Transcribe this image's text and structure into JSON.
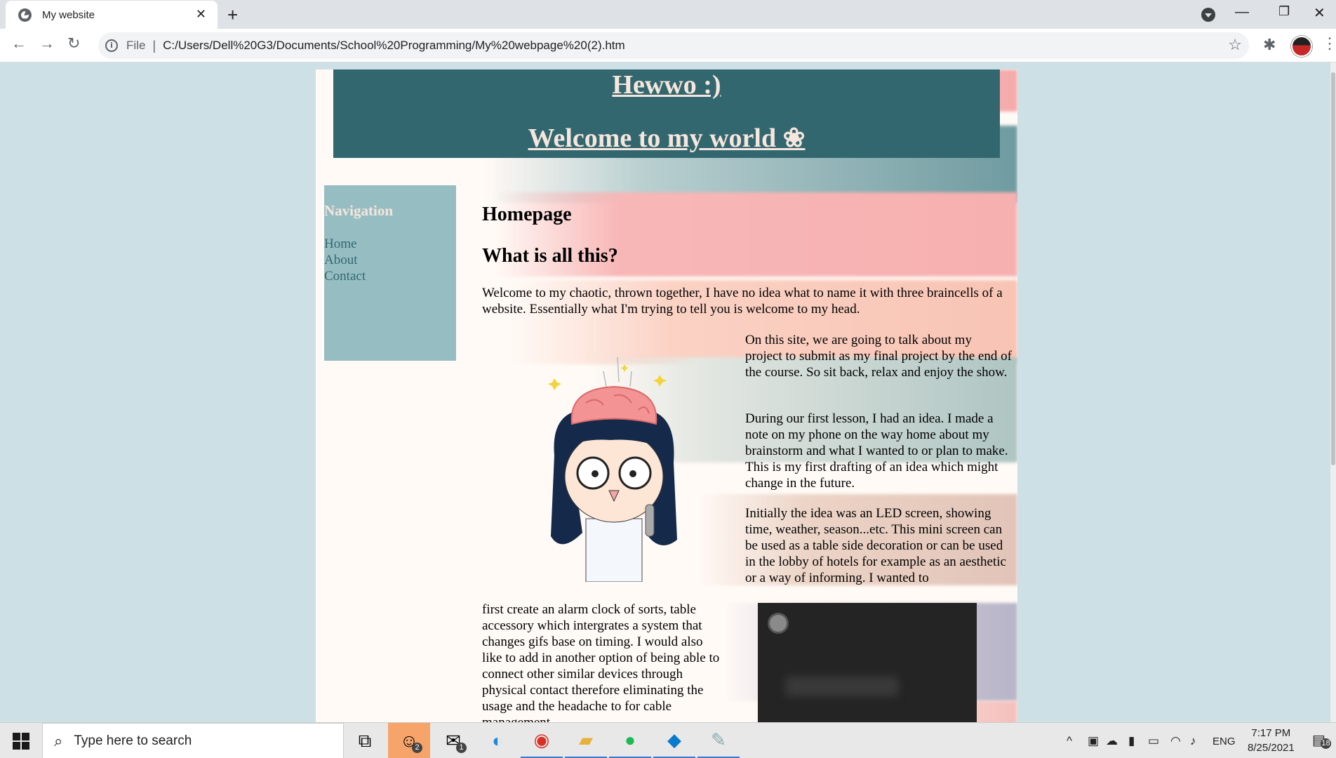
{
  "browser": {
    "tab_title": "My website",
    "tab_close": "✕",
    "new_tab": "+",
    "file_label": "File",
    "url": "C:/Users/Dell%20G3/Documents/School%20Programming/My%20webpage%20(2).htm"
  },
  "page": {
    "header_title": "Hewwo :)",
    "header_subtitle": "Welcome to my world ❀",
    "nav": {
      "title": "Navigation",
      "links": [
        "Home",
        "About",
        "Contact"
      ]
    },
    "content": {
      "heading_home": "Homepage",
      "heading_what": "What is all this?",
      "intro": "Welcome to my chaotic, thrown together, I have no idea what to name it with three braincells of a website. Essentially what I'm trying to tell you is welcome to my head.",
      "para1": "On this site, we are going to talk about my project to submit as my final project by the end of the course. So sit back, relax and enjoy the show.",
      "para2": "During our first lesson, I had an idea. I made a note on my phone on the way home about my brainstorm and what I wanted to or plan to make. This is my first drafting of an idea which might change in the future.",
      "para3": "Initially the idea was an LED screen, showing time, weather, season...etc. This mini screen can be used as a table side decoration or can be used in the lobby of hotels for example as an aesthetic or a way of informing. I wanted to",
      "para4": "first create an alarm clock of sorts, table accessory which intergrates a system that changes gifs base on timing. I would also like to add in another option of being able to connect other similar devices through physical contact therefore eliminating the usage and the headache to for cable management."
    },
    "colors": {
      "header_bg": "#33676f",
      "header_text": "#f6e6dd",
      "nav_bg": "#96bec2",
      "link": "#33676f",
      "page_bg": "#cde0e5"
    }
  },
  "taskbar": {
    "search_placeholder": "Type here to search",
    "lang": "ENG",
    "time": "7:17 PM",
    "date": "8/25/2021",
    "notif_count": "18",
    "discord_badge": "2",
    "mail_badge": "1"
  }
}
